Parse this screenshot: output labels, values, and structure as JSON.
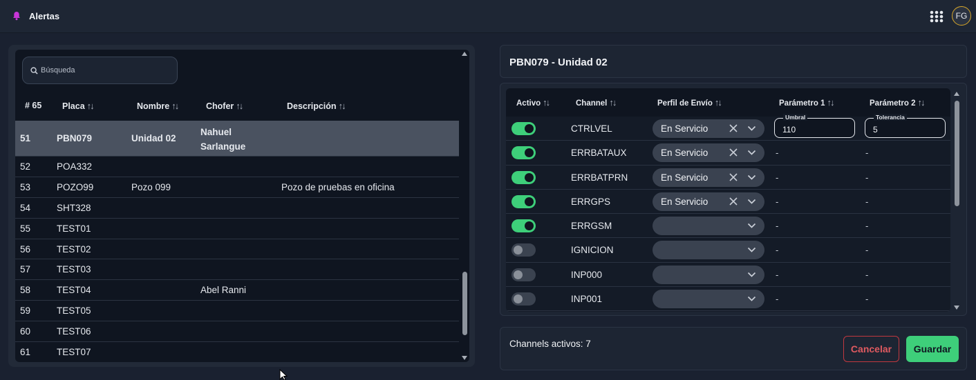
{
  "topbar": {
    "title": "Alertas",
    "bell_icon": "bell-icon",
    "bell_color": "#c935d8",
    "apps_icon": "grid-icon",
    "avatar_initials": "FG",
    "avatar_ring_color": "#d8a729"
  },
  "left": {
    "search_placeholder": "Búsqueda",
    "columns": {
      "count": "# 65",
      "placa": "Placa",
      "nombre": "Nombre",
      "chofer": "Chofer",
      "descripcion": "Descripción"
    },
    "rows": [
      {
        "num": "51",
        "placa": "PBN079",
        "nombre": "Unidad 02",
        "chofer": "Nahuel Sarlangue",
        "descripcion": "",
        "selected": true
      },
      {
        "num": "52",
        "placa": "POA332",
        "nombre": "",
        "chofer": "",
        "descripcion": ""
      },
      {
        "num": "53",
        "placa": "POZO99",
        "nombre": "Pozo 099",
        "chofer": "",
        "descripcion": "Pozo de pruebas en oficina"
      },
      {
        "num": "54",
        "placa": "SHT328",
        "nombre": "",
        "chofer": "",
        "descripcion": ""
      },
      {
        "num": "55",
        "placa": "TEST01",
        "nombre": "",
        "chofer": "",
        "descripcion": ""
      },
      {
        "num": "56",
        "placa": "TEST02",
        "nombre": "",
        "chofer": "",
        "descripcion": ""
      },
      {
        "num": "57",
        "placa": "TEST03",
        "nombre": "",
        "chofer": "",
        "descripcion": ""
      },
      {
        "num": "58",
        "placa": "TEST04",
        "nombre": "",
        "chofer": "Abel Ranni",
        "descripcion": ""
      },
      {
        "num": "59",
        "placa": "TEST05",
        "nombre": "",
        "chofer": "",
        "descripcion": ""
      },
      {
        "num": "60",
        "placa": "TEST06",
        "nombre": "",
        "chofer": "",
        "descripcion": ""
      },
      {
        "num": "61",
        "placa": "TEST07",
        "nombre": "",
        "chofer": "",
        "descripcion": ""
      }
    ]
  },
  "right": {
    "header_title": "PBN079 - Unidad 02",
    "columns": {
      "activo": "Activo",
      "channel": "Channel",
      "perfil": "Perfil de Envío",
      "param1": "Parámetro 1",
      "param2": "Parámetro 2"
    },
    "rows": [
      {
        "activo": true,
        "channel": "CTRLVEL",
        "perfil": "En Servicio",
        "param1": {
          "label": "Umbral",
          "value": "110"
        },
        "param2": {
          "label": "Tolerancia",
          "value": "5"
        }
      },
      {
        "activo": true,
        "channel": "ERRBATAUX",
        "perfil": "En Servicio",
        "param1": "-",
        "param2": "-"
      },
      {
        "activo": true,
        "channel": "ERRBATPRN",
        "perfil": "En Servicio",
        "param1": "-",
        "param2": "-"
      },
      {
        "activo": true,
        "channel": "ERRGPS",
        "perfil": "En Servicio",
        "param1": "-",
        "param2": "-"
      },
      {
        "activo": true,
        "channel": "ERRGSM",
        "perfil": "",
        "param1": "-",
        "param2": "-"
      },
      {
        "activo": false,
        "channel": "IGNICION",
        "perfil": "",
        "param1": "-",
        "param2": "-"
      },
      {
        "activo": false,
        "channel": "INP000",
        "perfil": "",
        "param1": "-",
        "param2": "-"
      },
      {
        "activo": false,
        "channel": "INP001",
        "perfil": "",
        "param1": "-",
        "param2": "-"
      }
    ],
    "footer_count": "Channels activos: 7",
    "cancel_label": "Cancelar",
    "save_label": "Guardar"
  },
  "colors": {
    "accent_green": "#3ecf7a",
    "cancel_red": "#c2383f",
    "background": "#1a2130"
  }
}
